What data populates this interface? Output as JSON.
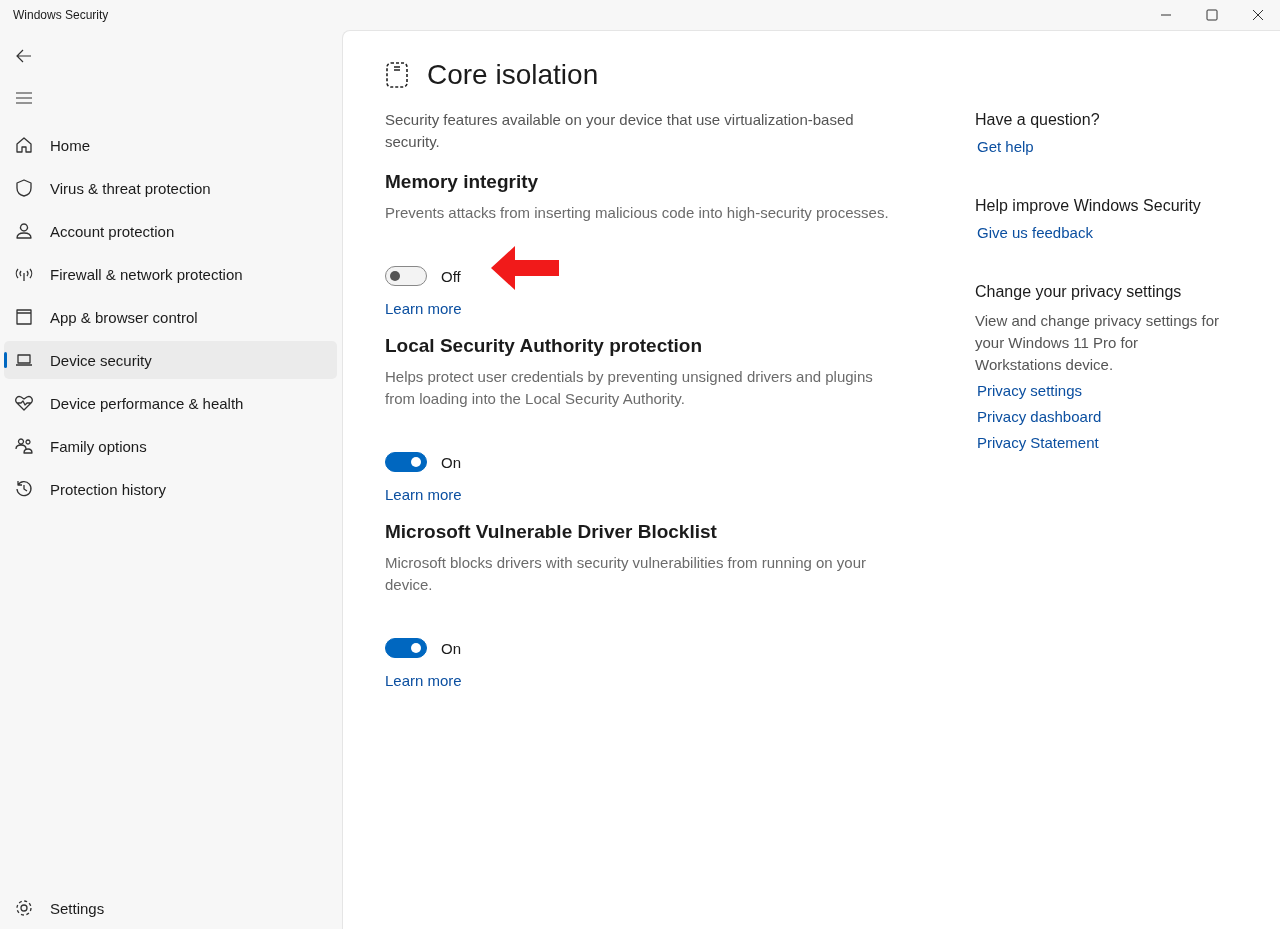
{
  "window": {
    "title": "Windows Security"
  },
  "sidebar": {
    "items": [
      {
        "label": "Home",
        "selected": false
      },
      {
        "label": "Virus & threat protection",
        "selected": false
      },
      {
        "label": "Account protection",
        "selected": false
      },
      {
        "label": "Firewall & network protection",
        "selected": false
      },
      {
        "label": "App & browser control",
        "selected": false
      },
      {
        "label": "Device security",
        "selected": true
      },
      {
        "label": "Device performance & health",
        "selected": false
      },
      {
        "label": "Family options",
        "selected": false
      },
      {
        "label": "Protection history",
        "selected": false
      }
    ],
    "settings": "Settings"
  },
  "page": {
    "title": "Core isolation",
    "description": "Security features available on your device that use virtualization-based security."
  },
  "sections": [
    {
      "title": "Memory integrity",
      "description": "Prevents attacks from inserting malicious code into high-security processes.",
      "on": false,
      "state_label": "Off",
      "link": "Learn more",
      "annotation_arrow": true
    },
    {
      "title": "Local Security Authority protection",
      "description": "Helps protect user credentials by preventing unsigned drivers and plugins from loading into the Local Security Authority.",
      "on": true,
      "state_label": "On",
      "link": "Learn more",
      "annotation_arrow": false
    },
    {
      "title": "Microsoft Vulnerable Driver Blocklist",
      "description": "Microsoft blocks drivers with security vulnerabilities from running on your device.",
      "on": true,
      "state_label": "On",
      "link": "Learn more",
      "annotation_arrow": false
    }
  ],
  "aside": [
    {
      "heading": "Have a question?",
      "links": [
        "Get help"
      ]
    },
    {
      "heading": "Help improve Windows Security",
      "links": [
        "Give us feedback"
      ]
    },
    {
      "heading": "Change your privacy settings",
      "text": "View and change privacy settings for your Windows 11 Pro for Workstations device.",
      "links": [
        "Privacy settings",
        "Privacy dashboard",
        "Privacy Statement"
      ]
    }
  ]
}
